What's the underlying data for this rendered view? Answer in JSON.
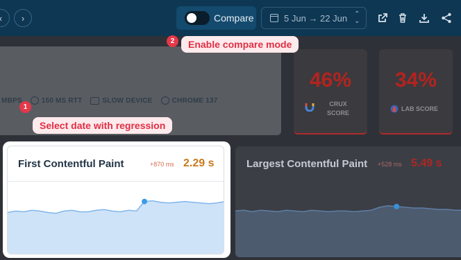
{
  "header": {
    "nav_prev_icon": "‹",
    "nav_next_icon": "›",
    "compare_label": "Compare",
    "compare_enabled": false,
    "date_range": "5 Jun → 22 Jun",
    "icons": [
      "external-link-icon",
      "trash-icon",
      "download-icon",
      "share-icon"
    ]
  },
  "test_settings": {
    "bandwidth": "MBPS",
    "rtt": "150 MS RTT",
    "device": "SLOW DEVICE",
    "browser": "CHROME 137"
  },
  "scores": {
    "crux": {
      "value": "46%",
      "label_line1": "CRUX",
      "label_line2": "SCORE"
    },
    "lab": {
      "value": "34%",
      "label": "LAB SCORE"
    }
  },
  "fcp": {
    "title": "First Contentful Paint",
    "delta": "+870 ms",
    "value": "2.29 s",
    "trend": [
      58,
      60,
      59,
      61,
      60,
      58,
      57,
      60,
      61,
      59,
      59,
      61,
      62,
      60,
      59,
      61,
      60,
      73,
      74,
      72,
      71,
      72,
      73,
      72,
      71,
      70,
      71,
      73
    ],
    "highlight_index": 17
  },
  "lcp": {
    "title": "Largest Contentful Paint",
    "delta": "+528 ms",
    "value": "5.49 s",
    "trend": [
      63,
      64,
      62,
      64,
      63,
      62,
      64,
      63,
      62,
      64,
      63,
      62,
      63,
      63,
      62,
      63,
      64,
      68,
      70,
      69,
      68,
      67,
      67,
      66,
      65,
      65,
      64,
      64
    ],
    "highlight_index": 19
  },
  "callouts": [
    {
      "number": "1",
      "text": "Select date with regression"
    },
    {
      "number": "2",
      "text": "Enable compare mode"
    }
  ],
  "colors": {
    "header_bg": "#0d3753",
    "regression_red": "#b3231f",
    "callout_red": "#e02f44",
    "chart_blue": "#3d9be9",
    "chart_fill": "#cfe3f8"
  }
}
